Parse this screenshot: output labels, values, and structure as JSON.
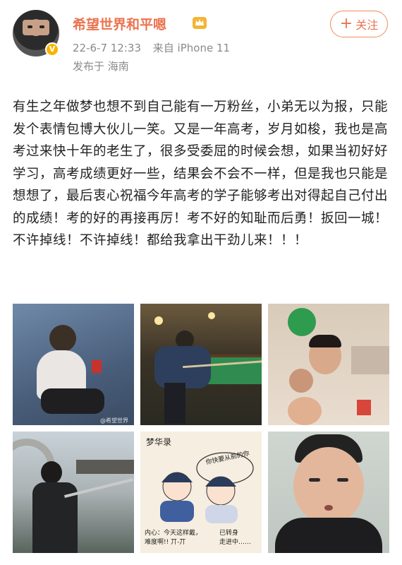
{
  "user": {
    "name": "希望世界和平嗯",
    "verified_badge": "V",
    "icon": "crown-icon"
  },
  "post_meta": {
    "date_time": "22-6-7 12:33",
    "source": "来自 iPhone 11",
    "location": "发布于 海南"
  },
  "follow_button": {
    "plus": "+",
    "label": "关注"
  },
  "post_text": "有生之年做梦也想不到自己能有一万粉丝，小弟无以为报，只能发个表情包博大伙儿一笑。又是一年高考，岁月如梭，我也是高考过来快十年的老生了，很多受委屈的时候会想，如果当初好好学习，高考成绩更好一些，结果会不会不一样，但是我也只能是想想了，最后衷心祝福今年高考的学子能够考出对得起自己付出的成绩！考的好的再接再厉！考不好的知耻而后勇！扳回一城！不许掉线！不许掉线！都给我拿出干劲儿来！！！",
  "images": {
    "watermark_1": "@希望世界",
    "comic_title": "梦华录",
    "comic_bubble": "你快要从前的你",
    "comic_caption_left": "内心：今天这样戴，\n难度啊!! 丌-丌",
    "comic_caption_right": "已转身\n走进中……"
  },
  "colors": {
    "accent": "#eb7350",
    "meta_gray": "#8a8a8a",
    "verified": "#f7b500"
  }
}
